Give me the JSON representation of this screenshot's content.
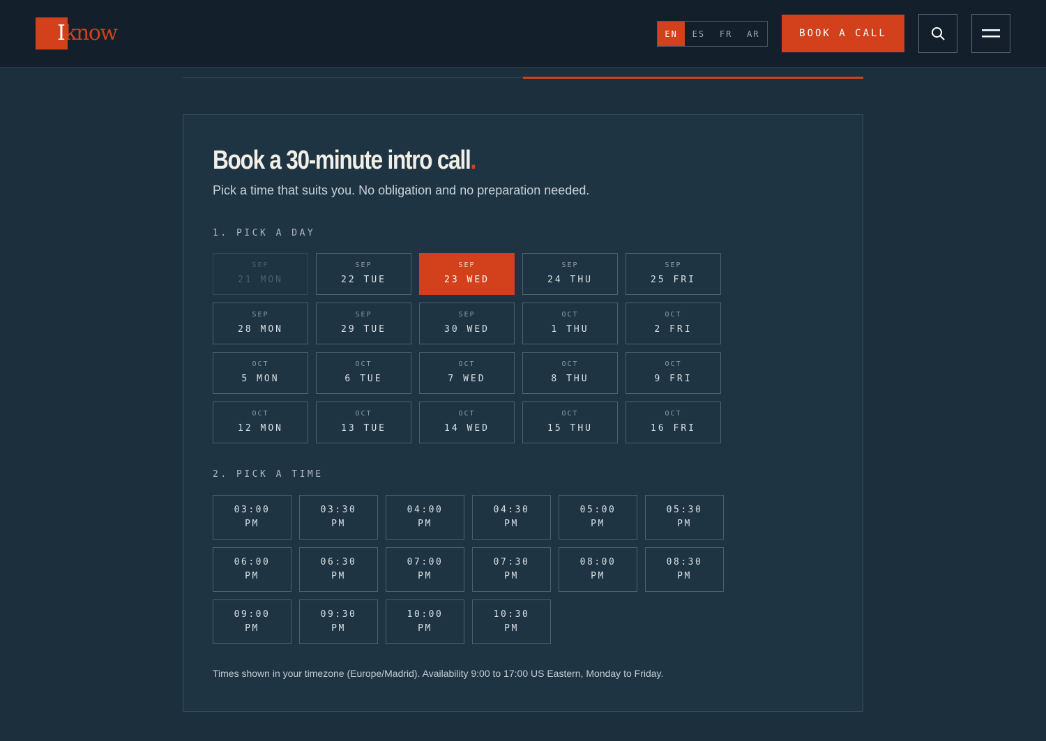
{
  "header": {
    "logo": {
      "first_letter": "I",
      "rest": "know"
    },
    "languages": [
      {
        "code": "EN",
        "active": true
      },
      {
        "code": "ES",
        "active": false
      },
      {
        "code": "FR",
        "active": false
      },
      {
        "code": "AR",
        "active": false
      }
    ],
    "book_button_label": "BOOK A CALL",
    "search_icon": "search-icon",
    "menu_icon": "hamburger-menu-icon"
  },
  "colors": {
    "accent": "#d2401c",
    "header_bg": "#13202b",
    "page_bg": "#1c2f3d",
    "card_bg": "#1f3443"
  },
  "progress": {
    "fraction_complete": 1.0,
    "highlighted_half": "right"
  },
  "booking": {
    "title": "Book a 30-minute intro call",
    "title_dot": ".",
    "subtitle": "Pick a time that suits you. No obligation and no preparation needed.",
    "day_section_label": "1. PICK A DAY",
    "time_section_label": "2. PICK A TIME",
    "days": [
      {
        "month": "SEP",
        "date": "21 MON",
        "state": "disabled"
      },
      {
        "month": "SEP",
        "date": "22 TUE",
        "state": "available"
      },
      {
        "month": "SEP",
        "date": "23 WED",
        "state": "selected"
      },
      {
        "month": "SEP",
        "date": "24 THU",
        "state": "available"
      },
      {
        "month": "SEP",
        "date": "25 FRI",
        "state": "available"
      },
      {
        "month": "SEP",
        "date": "28 MON",
        "state": "available"
      },
      {
        "month": "SEP",
        "date": "29 TUE",
        "state": "available"
      },
      {
        "month": "SEP",
        "date": "30 WED",
        "state": "available"
      },
      {
        "month": "OCT",
        "date": "1 THU",
        "state": "available"
      },
      {
        "month": "OCT",
        "date": "2 FRI",
        "state": "available"
      },
      {
        "month": "OCT",
        "date": "5 MON",
        "state": "available"
      },
      {
        "month": "OCT",
        "date": "6 TUE",
        "state": "available"
      },
      {
        "month": "OCT",
        "date": "7 WED",
        "state": "available"
      },
      {
        "month": "OCT",
        "date": "8 THU",
        "state": "available"
      },
      {
        "month": "OCT",
        "date": "9 FRI",
        "state": "available"
      },
      {
        "month": "OCT",
        "date": "12 MON",
        "state": "available"
      },
      {
        "month": "OCT",
        "date": "13 TUE",
        "state": "available"
      },
      {
        "month": "OCT",
        "date": "14 WED",
        "state": "available"
      },
      {
        "month": "OCT",
        "date": "15 THU",
        "state": "available"
      },
      {
        "month": "OCT",
        "date": "16 FRI",
        "state": "available"
      }
    ],
    "times": [
      {
        "time": "03:00",
        "period": "PM"
      },
      {
        "time": "03:30",
        "period": "PM"
      },
      {
        "time": "04:00",
        "period": "PM"
      },
      {
        "time": "04:30",
        "period": "PM"
      },
      {
        "time": "05:00",
        "period": "PM"
      },
      {
        "time": "05:30",
        "period": "PM"
      },
      {
        "time": "06:00",
        "period": "PM"
      },
      {
        "time": "06:30",
        "period": "PM"
      },
      {
        "time": "07:00",
        "period": "PM"
      },
      {
        "time": "07:30",
        "period": "PM"
      },
      {
        "time": "08:00",
        "period": "PM"
      },
      {
        "time": "08:30",
        "period": "PM"
      },
      {
        "time": "09:00",
        "period": "PM"
      },
      {
        "time": "09:30",
        "period": "PM"
      },
      {
        "time": "10:00",
        "period": "PM"
      },
      {
        "time": "10:30",
        "period": "PM"
      }
    ],
    "footnote": "Times shown in your timezone (Europe/Madrid). Availability 9:00 to 17:00 US Eastern, Monday to Friday."
  }
}
